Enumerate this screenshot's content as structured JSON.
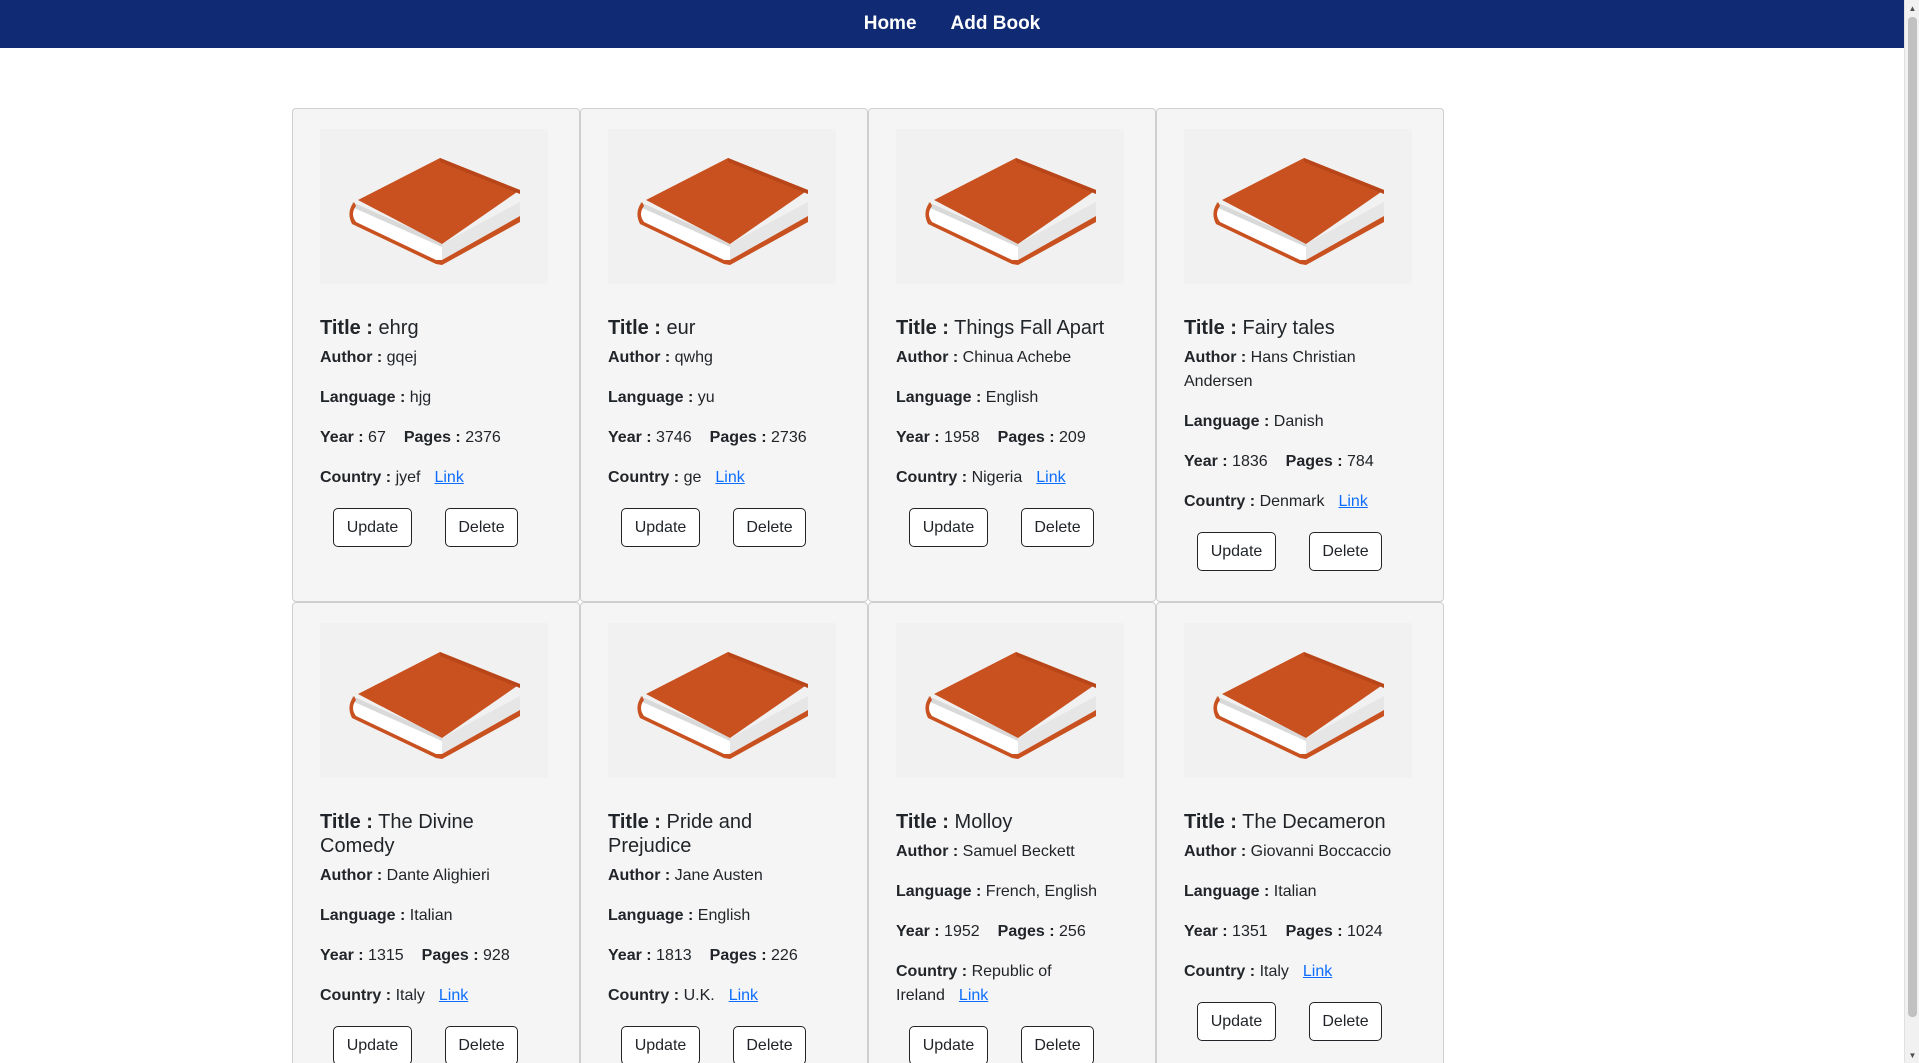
{
  "nav": {
    "home": "Home",
    "add_book": "Add Book"
  },
  "labels": {
    "title": "Title :",
    "author": "Author :",
    "language": "Language :",
    "year": "Year :",
    "pages": "Pages :",
    "country": "Country :",
    "link": "Link",
    "update": "Update",
    "delete": "Delete"
  },
  "books": [
    {
      "title": "ehrg",
      "author": "gqej",
      "language": "hjg",
      "year": "67",
      "pages": "2376",
      "country": "jyef"
    },
    {
      "title": "eur",
      "author": "qwhg",
      "language": "yu",
      "year": "3746",
      "pages": "2736",
      "country": "ge"
    },
    {
      "title": "Things Fall Apart",
      "author": "Chinua Achebe",
      "language": "English",
      "year": "1958",
      "pages": "209",
      "country": "Nigeria"
    },
    {
      "title": "Fairy tales",
      "author": "Hans Christian Andersen",
      "language": "Danish",
      "year": "1836",
      "pages": "784",
      "country": "Denmark"
    },
    {
      "title": "The Divine Comedy",
      "author": "Dante Alighieri",
      "language": "Italian",
      "year": "1315",
      "pages": "928",
      "country": "Italy"
    },
    {
      "title": "Pride and Prejudice",
      "author": "Jane Austen",
      "language": "English",
      "year": "1813",
      "pages": "226",
      "country": "U.K."
    },
    {
      "title": "Molloy",
      "author": "Samuel Beckett",
      "language": "French, English",
      "year": "1952",
      "pages": "256",
      "country": "Republic of Ireland"
    },
    {
      "title": "The Decameron",
      "author": "Giovanni Boccaccio",
      "language": "Italian",
      "year": "1351",
      "pages": "1024",
      "country": "Italy"
    }
  ],
  "colors": {
    "navbar": "#102a74",
    "book_cover": "#c8511f",
    "link": "#0d6efd"
  },
  "icons": {
    "cover": "book-icon"
  }
}
